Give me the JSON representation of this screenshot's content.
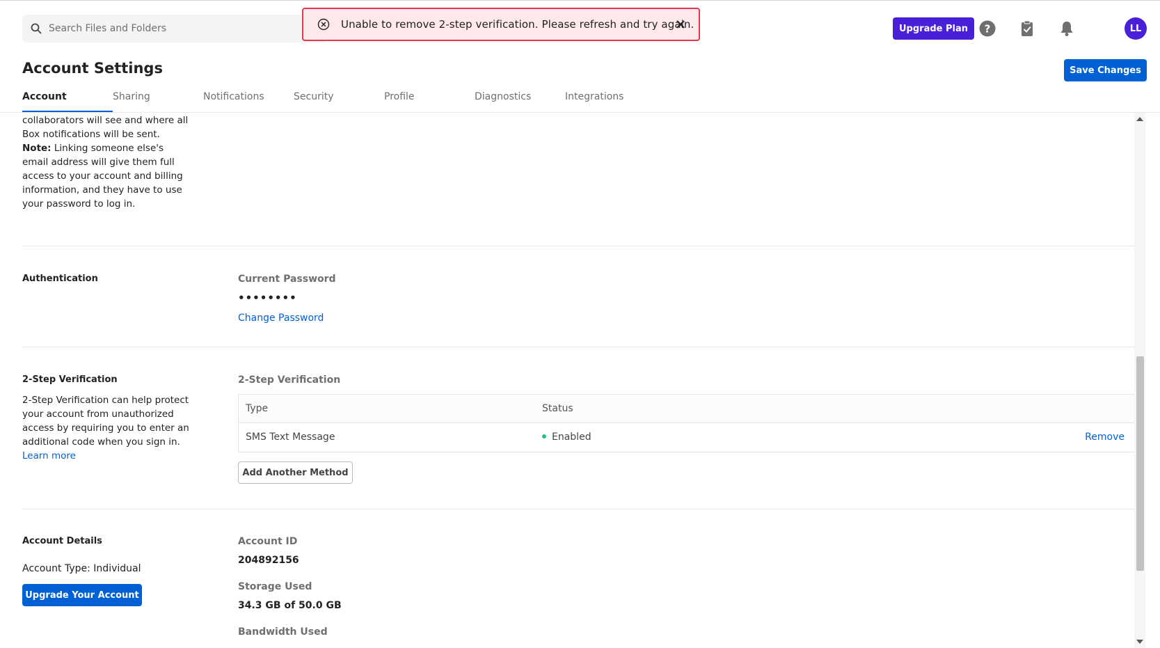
{
  "header": {
    "search_placeholder": "Search Files and Folders",
    "upgrade_plan": "Upgrade Plan",
    "avatar_initials": "LL",
    "icons": [
      "help-icon",
      "tasks-icon",
      "bell-icon"
    ]
  },
  "toast": {
    "message": "Unable to remove 2-step verification. Please refresh and try again."
  },
  "page": {
    "title": "Account Settings",
    "save_changes": "Save Changes"
  },
  "tabs": [
    {
      "label": "Account",
      "active": true
    },
    {
      "label": "Sharing"
    },
    {
      "label": "Notifications"
    },
    {
      "label": "Security"
    },
    {
      "label": "Profile"
    },
    {
      "label": "Diagnostics"
    },
    {
      "label": "Integrations"
    }
  ],
  "intro": {
    "text_before": "collaborators will see and where all Box notifications will be sent.",
    "note_label": "Note:",
    "text_after": "Linking someone else's email address will give them full access to your account and billing information, and they have to use your password to log in."
  },
  "authentication": {
    "title": "Authentication",
    "current_password_label": "Current Password",
    "password_mask": "••••••••",
    "change_password": "Change Password"
  },
  "two_step": {
    "title": "2-Step Verification",
    "description": "2-Step Verification can help protect your account from unauthorized access by requiring you to enter an additional code when you sign in.",
    "learn_more": "Learn more",
    "field_label": "2-Step Verification",
    "columns": {
      "type": "Type",
      "status": "Status"
    },
    "rows": [
      {
        "type": "SMS Text Message",
        "status": "Enabled",
        "action": "Remove"
      }
    ],
    "status_color": "#26c281",
    "add_method": "Add Another Method"
  },
  "account_details": {
    "title": "Account Details",
    "account_type": "Account Type: Individual",
    "upgrade_button": "Upgrade Your Account",
    "account_id_label": "Account ID",
    "account_id": "204892156",
    "storage_label": "Storage Used",
    "storage_value": "34.3 GB of 50.0 GB",
    "bandwidth_label": "Bandwidth Used"
  },
  "colors": {
    "brand_purple": "#4a1fd8",
    "primary_blue": "#0061d5",
    "error_red": "#e3384d"
  }
}
